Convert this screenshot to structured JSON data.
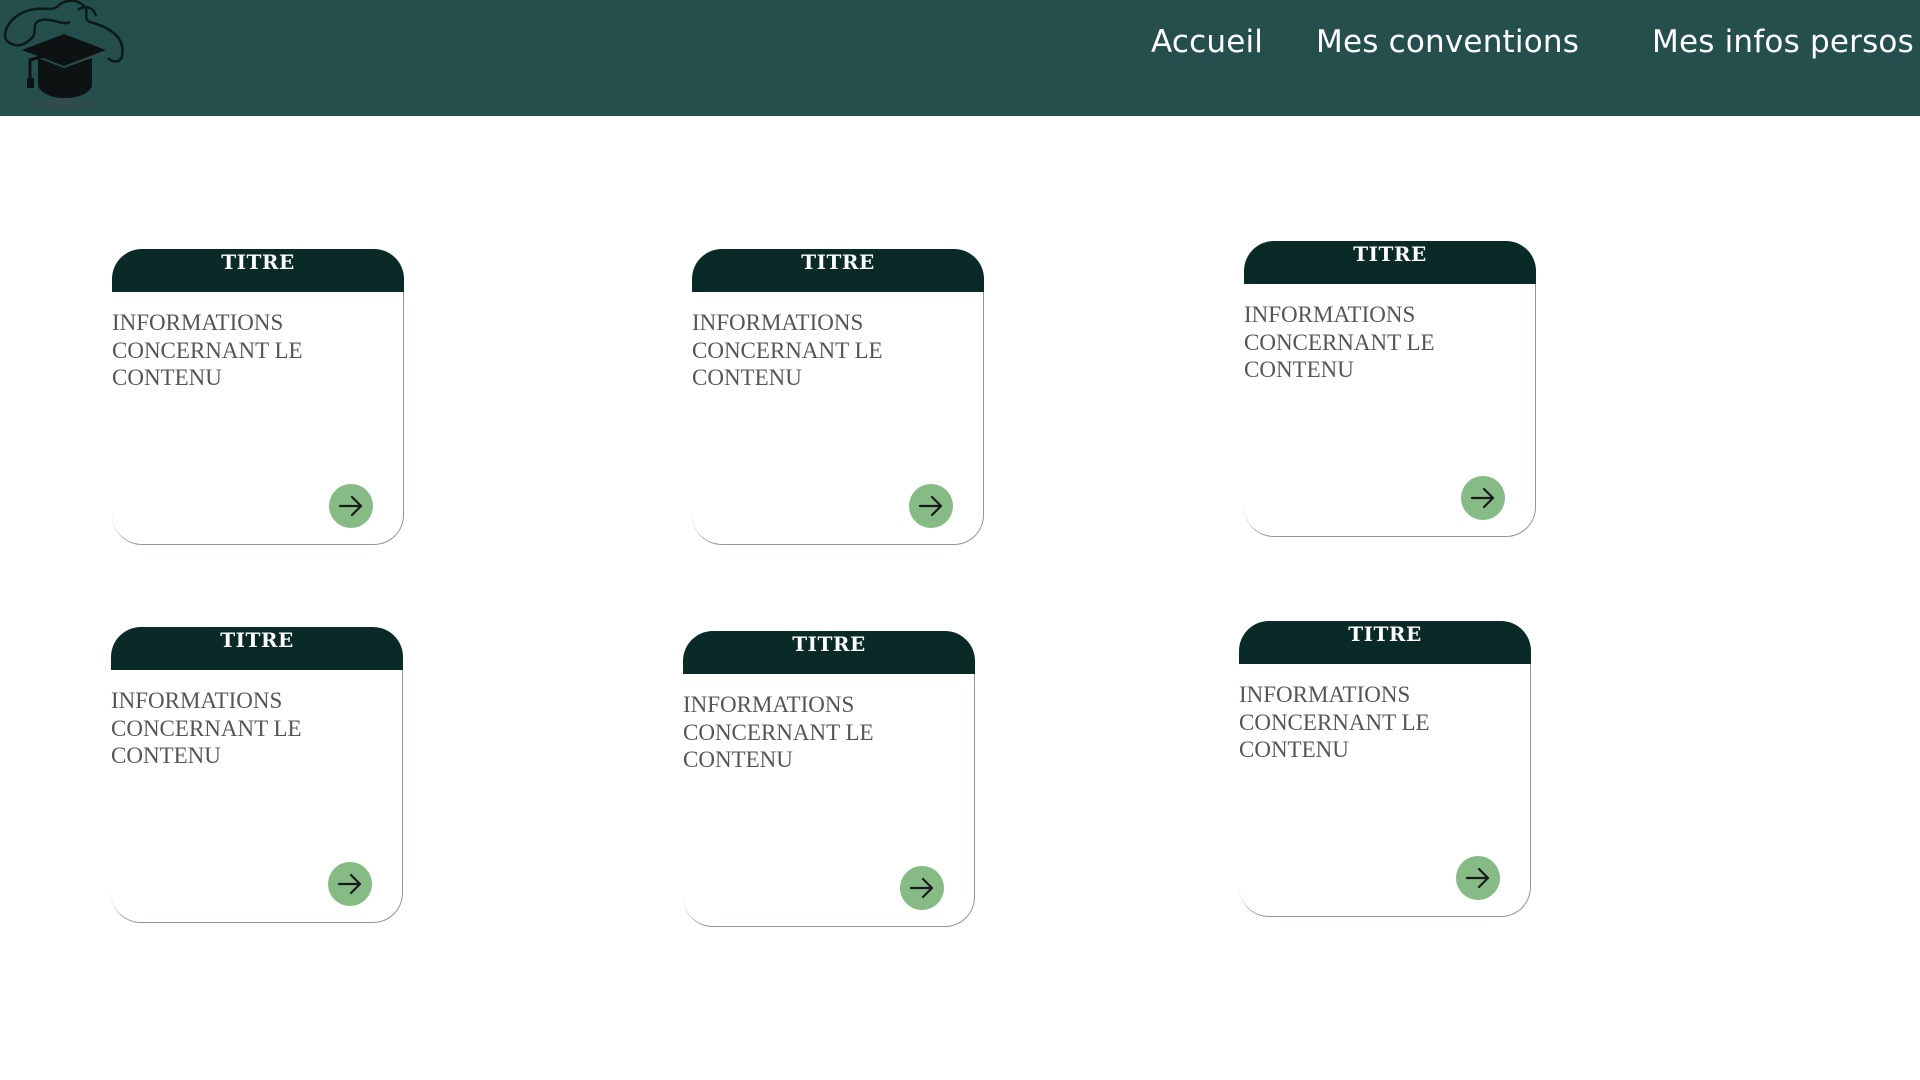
{
  "header": {
    "background": "#244f4d",
    "logo_icon": "graduation-cap-icon",
    "nav": [
      {
        "label": "Accueil"
      },
      {
        "label": "Mes conventions"
      },
      {
        "label": "Mes infos persos"
      }
    ]
  },
  "cards": [
    {
      "title": "TITRE",
      "info": "INFORMATIONS CONCERNANT LE CONTENU",
      "action_icon": "arrow-right-icon"
    },
    {
      "title": "TITRE",
      "info": "INFORMATIONS CONCERNANT LE CONTENU",
      "action_icon": "arrow-right-icon"
    },
    {
      "title": "TITRE",
      "info": "INFORMATIONS CONCERNANT LE CONTENU",
      "action_icon": "arrow-right-icon"
    },
    {
      "title": "TITRE",
      "info": "INFORMATIONS CONCERNANT LE CONTENU",
      "action_icon": "arrow-right-icon"
    },
    {
      "title": "TITRE",
      "info": "INFORMATIONS CONCERNANT LE CONTENU",
      "action_icon": "arrow-right-icon"
    },
    {
      "title": "TITRE",
      "info": "INFORMATIONS CONCERNANT LE CONTENU",
      "action_icon": "arrow-right-icon"
    }
  ],
  "colors": {
    "card_header": "#0a2a27",
    "action_button": "#86bb86",
    "card_text": "#555555"
  }
}
